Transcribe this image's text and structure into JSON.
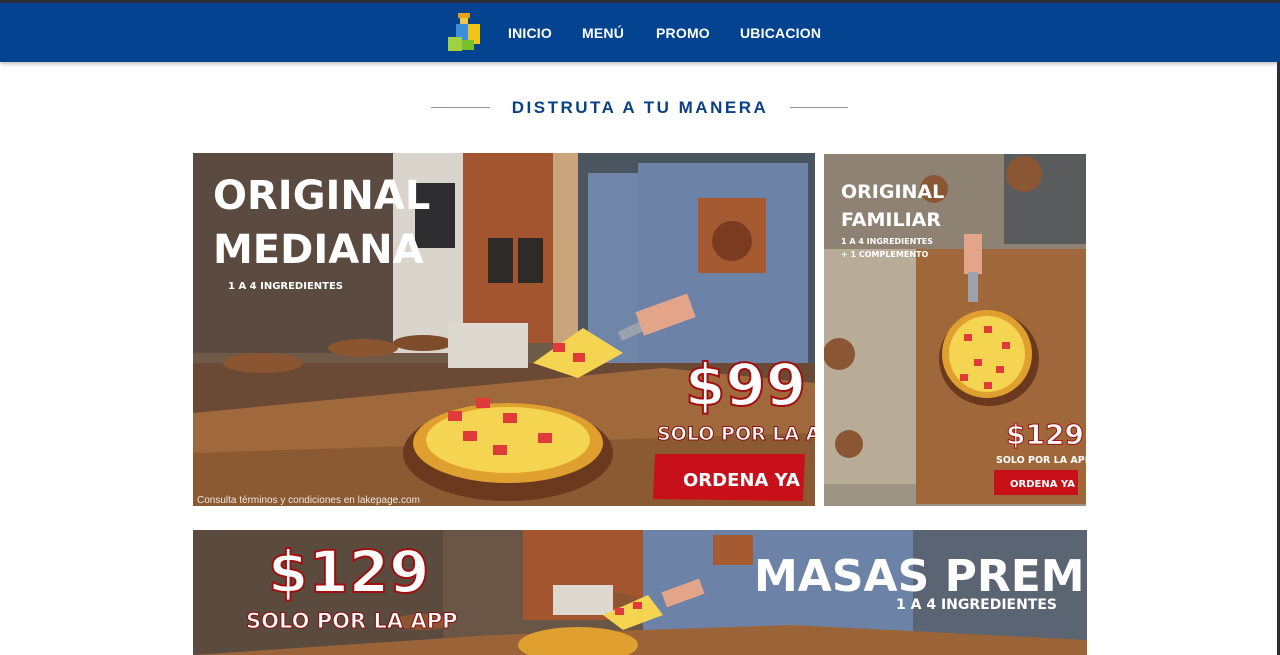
{
  "nav": {
    "links": [
      "INICIO",
      "MENÚ",
      "PROMO",
      "UBICACION"
    ]
  },
  "section": {
    "title": "DISTRUTA A TU MANERA"
  },
  "promos": [
    {
      "title_line1": "ORIGINAL",
      "title_line2": "MEDIANA",
      "subtitle": "1 A 4 INGREDIENTES",
      "price": "$99",
      "price_note": "SOLO POR LA APP",
      "cta": "ORDENA YA",
      "legal": "Consulta términos y condiciones en lakepage.com"
    },
    {
      "title_line1": "ORIGINAL",
      "title_line2": "FAMILIAR",
      "subtitle_line1": "1 A 4 INGREDIENTES",
      "subtitle_line2": "+ 1 COMPLEMENTO",
      "price": "$129",
      "price_note": "SOLO POR LA APP",
      "cta": "ORDENA YA"
    },
    {
      "price": "$129",
      "price_note": "SOLO POR LA APP",
      "title": "MASAS PREMIUM",
      "subtitle": "1 A 4 INGREDIENTES"
    }
  ],
  "colors": {
    "nav_bg": "#034390",
    "title": "#0b3f86",
    "cta_red": "#c8101a"
  }
}
